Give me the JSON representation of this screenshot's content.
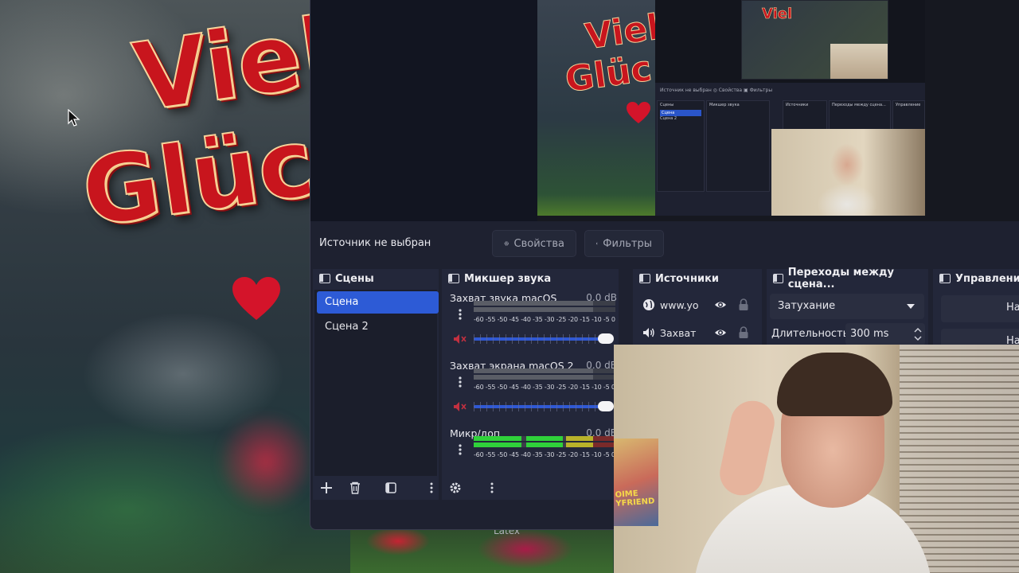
{
  "wallpaper": {
    "title_line1": "Viel",
    "title_line2": "Glück",
    "caption": "Latex"
  },
  "preview": {
    "canvas_title_line1": "Viel",
    "canvas_title_line2": "Glüc"
  },
  "nested_obs": {
    "header": "Источник не выбран   ◎ Свойства   ▣ Фильтры",
    "scenes_title": "Сцены",
    "scene_active": "Сцена",
    "scene_other": "Сцена 2",
    "mixer_title": "Микшер звука",
    "sources_title": "Источники",
    "transitions_title": "Переходы между сцена...",
    "controls_title": "Управление"
  },
  "source_bar": {
    "no_source": "Источник не выбран",
    "properties_label": "Свойства",
    "filters_label": "Фильтры"
  },
  "scenes": {
    "title": "Сцены",
    "items": [
      "Сцена",
      "Сцена 2"
    ],
    "active_index": 0
  },
  "mixer": {
    "title": "Микшер звука",
    "scale": "-60 -55 -50 -45 -40 -35 -30 -25 -20 -15 -10 -5 0",
    "channels": [
      {
        "name": "Захват звука macOS",
        "db": "0.0 dB",
        "muted": true
      },
      {
        "name": "Захват экрана macOS 2",
        "db": "0.0 dB",
        "muted": true
      },
      {
        "name": "Микр/доп",
        "db": "0.0 dB",
        "muted": false
      }
    ]
  },
  "sources": {
    "title": "Источники",
    "items": [
      "www.yo",
      "Захват "
    ]
  },
  "transitions": {
    "title": "Переходы между сцена...",
    "selected": "Затухание",
    "duration_label": "Длительность",
    "duration_value": "300 ms"
  },
  "controls": {
    "title": "Управление",
    "start_label": "Начат",
    "second_label": "На"
  },
  "webcam": {
    "poster_text": "OIME YFRIEND"
  },
  "colors": {
    "accent": "#2d5bd6",
    "panel": "#23273a",
    "window": "#1e2130",
    "mute": "#d03040",
    "meter_green": "#2fd13a",
    "title_red": "#c8151d"
  }
}
